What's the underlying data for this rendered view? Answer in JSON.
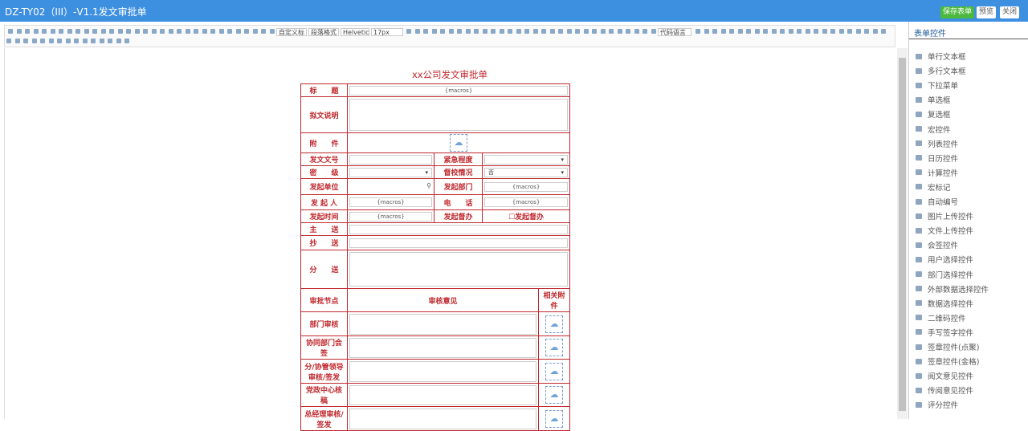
{
  "window": {
    "title": "DZ-TY02（III）-V1.1发文审批单",
    "save": "保存表单",
    "preview": "预览",
    "close": "关闭"
  },
  "toolbar": {
    "custom_style": "自定义标",
    "paragraph": "段落格式",
    "font": "Helvetic",
    "size": "17px",
    "code_lang": "代码语言"
  },
  "sidebar": {
    "title": "表单控件",
    "items": [
      "单行文本框",
      "多行文本框",
      "下拉菜单",
      "单选框",
      "复选框",
      "宏控件",
      "列表控件",
      "日历控件",
      "计算控件",
      "宏标记",
      "自动编号",
      "图片上传控件",
      "文件上传控件",
      "会签控件",
      "用户选择控件",
      "部门选择控件",
      "外部数据选择控件",
      "数据选择控件",
      "二维码控件",
      "手写签字控件",
      "签章控件(点聚)",
      "签章控件(金格)",
      "阅文意见控件",
      "传阅意见控件",
      "评分控件"
    ]
  },
  "form": {
    "title": "xx公司发文审批单",
    "macro": "{macros}",
    "labels": {
      "subject": "标　　题",
      "desc": "拟文说明",
      "attachment": "附　　件",
      "doc_no": "发文文号",
      "urgency": "紧急程度",
      "secret": "密　　级",
      "supervise": "督校情况",
      "supervise_value": "否",
      "unit": "发起单位",
      "dept": "发起部门",
      "initiator": "发 起 人",
      "phone": "电　　话",
      "time": "发起时间",
      "sup2": "发起督办",
      "sup2_check": "发起督办",
      "main_to": "主　　送",
      "cc": "抄　　送",
      "dist": "分　　送",
      "node": "审批节点",
      "opinion": "审核意见",
      "rel_att": "相关附件"
    },
    "nodes": [
      "部门审核",
      "协同部门会签",
      "分/协管领导审核/签发",
      "党政中心核稿",
      "总经理审核/签发"
    ]
  }
}
